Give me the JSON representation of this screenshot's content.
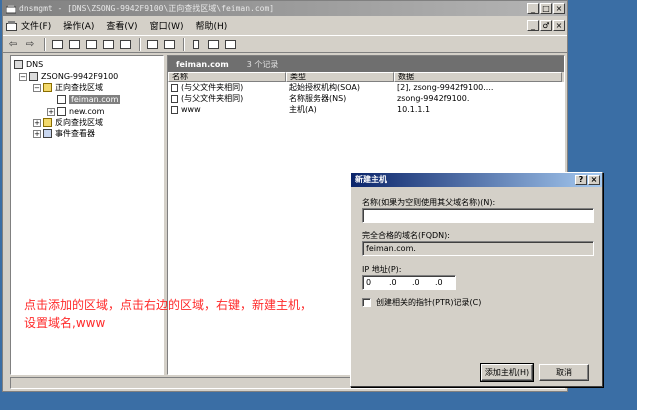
{
  "window": {
    "title": "dnsmgmt - [DNS\\ZSONG-9942F9100\\正向查找区域\\feiman.com]",
    "buttons": [
      "_",
      "□",
      "×"
    ]
  },
  "menubar": {
    "items": [
      "文件(F)",
      "操作(A)",
      "查看(V)",
      "窗口(W)",
      "帮助(H)"
    ],
    "mdi_buttons": [
      "_",
      "♂",
      "×"
    ]
  },
  "toolbar": {
    "icons": [
      "back-icon",
      "forward-icon",
      "up-icon",
      "show-tree-icon",
      "properties-icon",
      "refresh-icon",
      "export-icon",
      "help-icon",
      "console-icon",
      "server-icon",
      "zone-icon",
      "record-icon"
    ]
  },
  "tree": {
    "root": "DNS",
    "server": "ZSONG-9942F9100",
    "forward_zones": "正向查找区域",
    "zone_selected": "feiman.com",
    "zone_other": "new.com",
    "reverse_zones": "反向查找区域",
    "event_viewer": "事件查看器"
  },
  "list": {
    "header_title": "feiman.com",
    "record_count": "3 个记录",
    "columns": [
      "名称",
      "类型",
      "数据"
    ],
    "rows": [
      {
        "name": "(与父文件夹相同)",
        "type": "起始授权机构(SOA)",
        "data": "[2], zsong-9942f9100...."
      },
      {
        "name": "(与父文件夹相同)",
        "type": "名称服务器(NS)",
        "data": "zsong-9942f9100."
      },
      {
        "name": "www",
        "type": "主机(A)",
        "data": "10.1.1.1"
      }
    ]
  },
  "annotation": {
    "line1": "点击添加的区域，点击右边的区域，右键，新建主机，",
    "line2": "设置域名,www"
  },
  "dialog": {
    "title": "新建主机",
    "title_buttons": [
      "?",
      "×"
    ],
    "name_label": "名称(如果为空则使用其父域名称)(N):",
    "name_value": "",
    "fqdn_label": "完全合格的域名(FQDN):",
    "fqdn_value": "feiman.com.",
    "ip_label": "IP 地址(P):",
    "ip_octets": [
      "0",
      ".0",
      ".0",
      ".0"
    ],
    "ptr_label": "创建相关的指针(PTR)记录(C)",
    "add_button": "添加主机(H)",
    "cancel_button": "取消"
  }
}
